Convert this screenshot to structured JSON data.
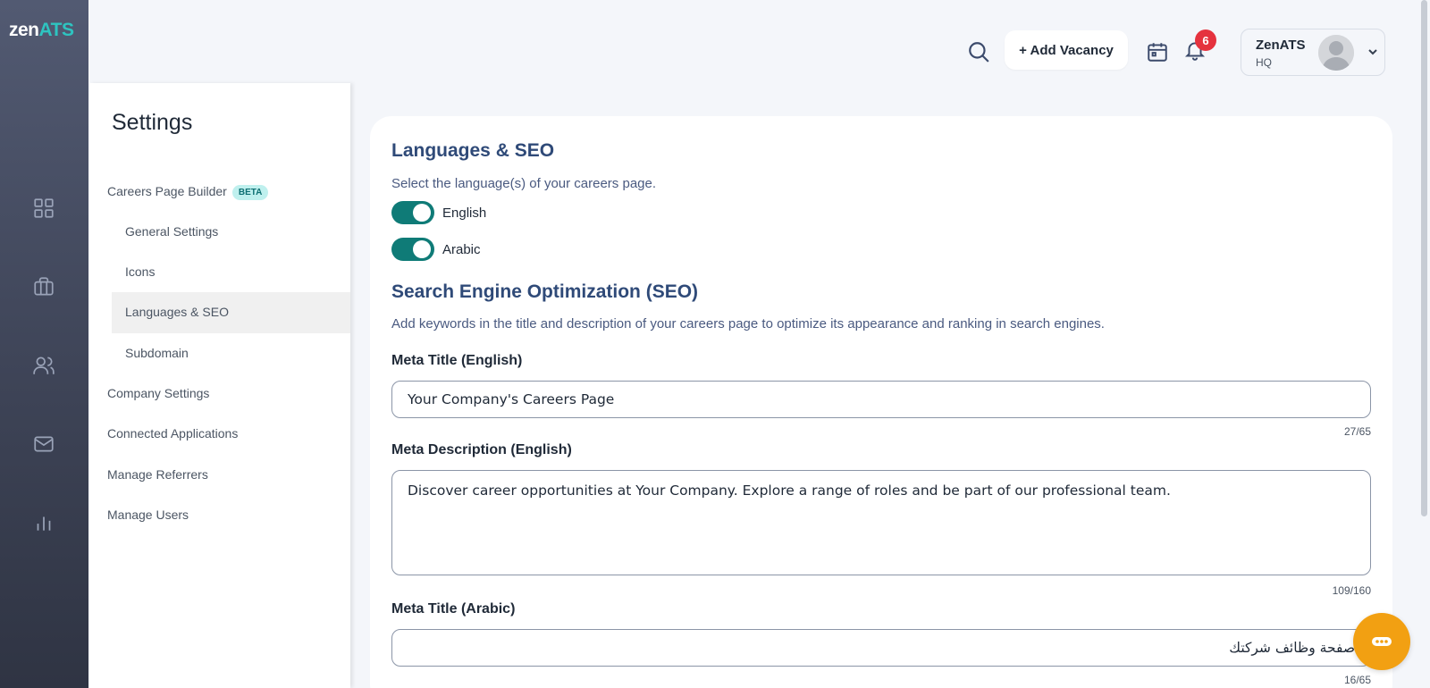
{
  "app": {
    "logo_main": "zen",
    "logo_accent": "ATS"
  },
  "rail": {
    "items": [
      {
        "icon": "dashboard-grid-icon"
      },
      {
        "icon": "briefcase-icon"
      },
      {
        "icon": "users-icon"
      },
      {
        "icon": "mail-icon"
      },
      {
        "icon": "bar-chart-icon"
      }
    ]
  },
  "header": {
    "add_vacancy_label": "+ Add Vacancy",
    "notification_count": "6",
    "user_name": "ZenATS",
    "user_sub": "HQ"
  },
  "settings": {
    "title": "Settings",
    "beta_label": "BETA",
    "items": [
      {
        "label": "Careers Page Builder",
        "level": "top"
      },
      {
        "label": "General Settings",
        "level": "sub"
      },
      {
        "label": "Icons",
        "level": "sub"
      },
      {
        "label": "Languages & SEO",
        "level": "sub",
        "active": true
      },
      {
        "label": "Subdomain",
        "level": "sub"
      },
      {
        "label": "Company Settings",
        "level": "top"
      },
      {
        "label": "Connected Applications",
        "level": "top"
      },
      {
        "label": "Manage Referrers",
        "level": "top"
      },
      {
        "label": "Manage Users",
        "level": "top"
      }
    ]
  },
  "main": {
    "languages": {
      "title": "Languages & SEO",
      "description": "Select the language(s) of your careers page.",
      "options": [
        {
          "label": "English",
          "enabled": true
        },
        {
          "label": "Arabic",
          "enabled": true
        }
      ]
    },
    "seo": {
      "title": "Search Engine Optimization (SEO)",
      "description": "Add keywords in the title and description of your careers page to optimize its appearance and ranking in search engines.",
      "meta_title_en": {
        "label": "Meta Title (English)",
        "value": "Your Company's Careers Page",
        "counter": "27/65"
      },
      "meta_desc_en": {
        "label": "Meta Description (English)",
        "value": "Discover career opportunities at Your Company. Explore a range of roles and be part of our professional team.",
        "counter": "109/160"
      },
      "meta_title_ar": {
        "label": "Meta Title (Arabic)",
        "value": "صفحة وظائف شركتك",
        "counter": "16/65"
      }
    }
  },
  "colors": {
    "rail_top": "#525a72",
    "rail_bottom": "#2f3443",
    "accent_teal": "#0f7b77",
    "heading_blue": "#2f4a78",
    "badge_red": "#e5323e",
    "fab_orange": "#f2a012"
  }
}
